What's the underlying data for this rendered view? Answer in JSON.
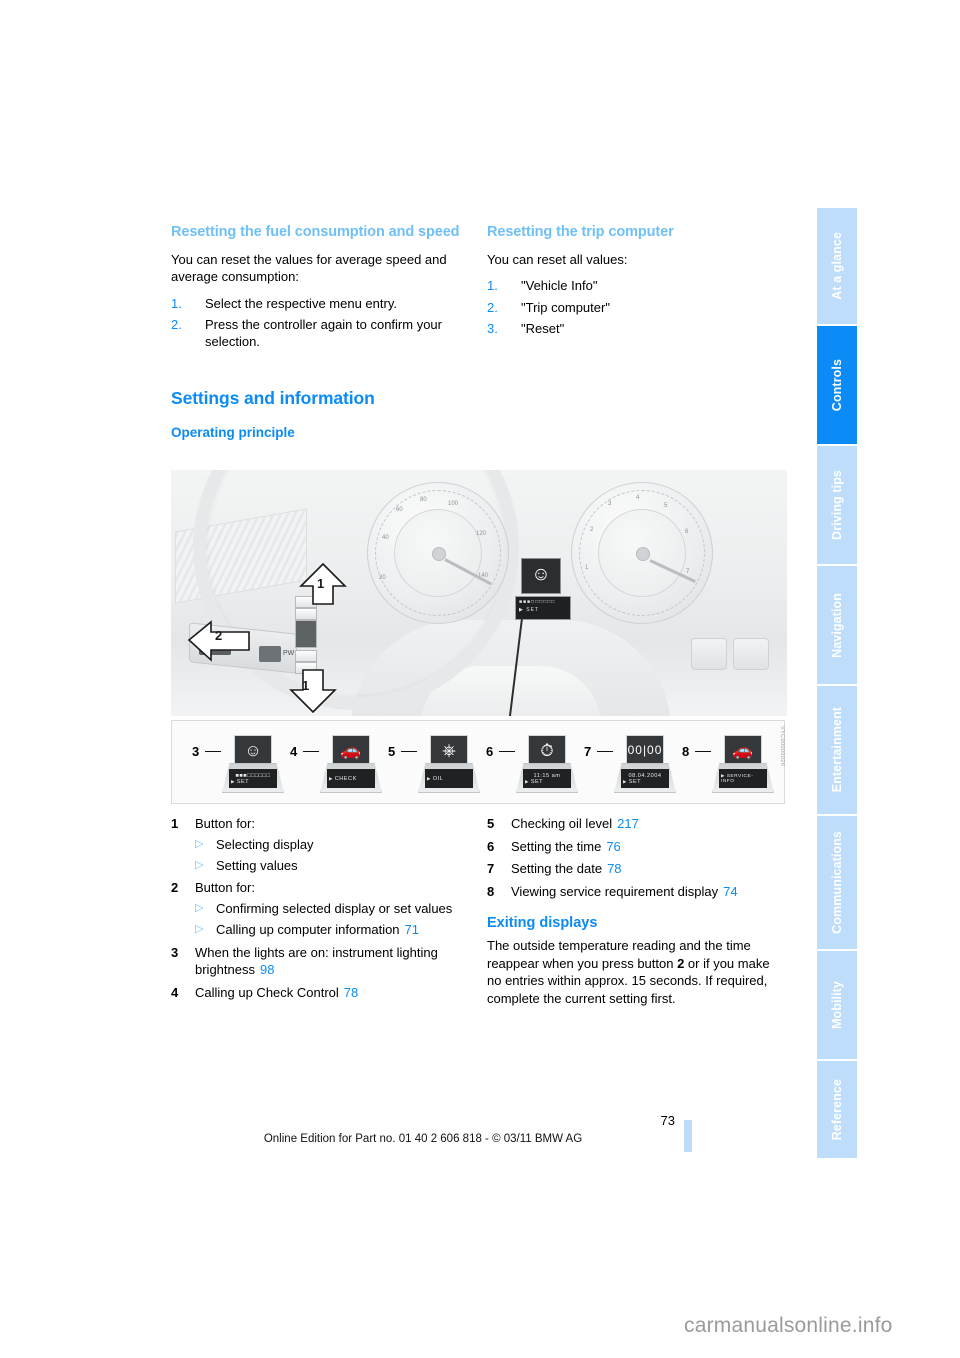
{
  "document": {
    "page_number": "73",
    "footer": "Online Edition for Part no. 01 40 2 606 818 - © 03/11 BMW AG",
    "watermark": "carmanualsonline.info"
  },
  "colors": {
    "accent": "#0b8bf5",
    "accent_light": "#6fc0f7",
    "tab_inactive": "#bdddfb",
    "tab_active": "#0b8bf5"
  },
  "tabs": [
    {
      "label": "At a glance",
      "active": false
    },
    {
      "label": "Controls",
      "active": true
    },
    {
      "label": "Driving tips",
      "active": false
    },
    {
      "label": "Navigation",
      "active": false
    },
    {
      "label": "Entertainment",
      "active": false
    },
    {
      "label": "Communications",
      "active": false
    },
    {
      "label": "Mobility",
      "active": false
    },
    {
      "label": "Reference",
      "active": false
    }
  ],
  "left_column": {
    "heading": "Resetting the fuel consumption and speed",
    "intro": "You can reset the values for average speed and average consumption:",
    "steps": [
      {
        "num": "1.",
        "text": "Select the respective menu entry."
      },
      {
        "num": "2.",
        "text": "Press the controller again to confirm your selection."
      }
    ]
  },
  "right_column": {
    "heading": "Resetting the trip computer",
    "intro": "You can reset all values:",
    "steps": [
      {
        "num": "1.",
        "text": "\"Vehicle Info\""
      },
      {
        "num": "2.",
        "text": "\"Trip computer\""
      },
      {
        "num": "3.",
        "text": "\"Reset\""
      }
    ]
  },
  "section": {
    "title": "Settings and information",
    "subtitle": "Operating principle"
  },
  "figure": {
    "code": "VYC00000026",
    "arrow_labels": [
      "1",
      "2",
      "1"
    ],
    "stalk_labels": [
      "BC",
      "PW"
    ],
    "displays": [
      {
        "key": "3",
        "icon": "person-seat-icon",
        "lcd_line1": "■■■□□□□□□",
        "lcd_line2": "SET"
      },
      {
        "key": "4",
        "icon": "car-icon",
        "lcd_line1": "",
        "lcd_line2": "CHECK"
      },
      {
        "key": "5",
        "icon": "oil-can-icon",
        "lcd_line1": "",
        "lcd_line2": "OIL"
      },
      {
        "key": "6",
        "icon": "clock-icon",
        "lcd_line1": "11:15 am",
        "lcd_line2": "SET"
      },
      {
        "key": "7",
        "icon": "date-digits-icon",
        "lcd_line1": "08.04.2004",
        "lcd_line2": "SET"
      },
      {
        "key": "8",
        "icon": "car-icon",
        "lcd_line1": "",
        "lcd_line2": "SERVICE-INFO"
      }
    ]
  },
  "key_left": [
    {
      "num": "1",
      "text": "Button for:",
      "sub": [
        {
          "text": "Selecting display",
          "ref": ""
        },
        {
          "text": "Setting values",
          "ref": ""
        }
      ]
    },
    {
      "num": "2",
      "text": "Button for:",
      "sub": [
        {
          "text": "Confirming selected display or set values",
          "ref": ""
        },
        {
          "text": "Calling up computer information",
          "ref": "71"
        }
      ]
    },
    {
      "num": "3",
      "text": "When the lights are on: instrument lighting brightness",
      "ref": "98",
      "sub": []
    },
    {
      "num": "4",
      "text": "Calling up Check Control",
      "ref": "78",
      "sub": []
    }
  ],
  "key_right": [
    {
      "num": "5",
      "text": "Checking oil level",
      "ref": "217"
    },
    {
      "num": "6",
      "text": "Setting the time",
      "ref": "76"
    },
    {
      "num": "7",
      "text": "Setting the date",
      "ref": "78"
    },
    {
      "num": "8",
      "text": "Viewing service requirement display",
      "ref": "74"
    }
  ],
  "exiting": {
    "heading": "Exiting displays",
    "body_before": "The outside temperature reading and the time reappear when you press button ",
    "bold": "2",
    "body_after": " or if you make no entries within approx. 15 seconds. If required, complete the current setting first."
  }
}
